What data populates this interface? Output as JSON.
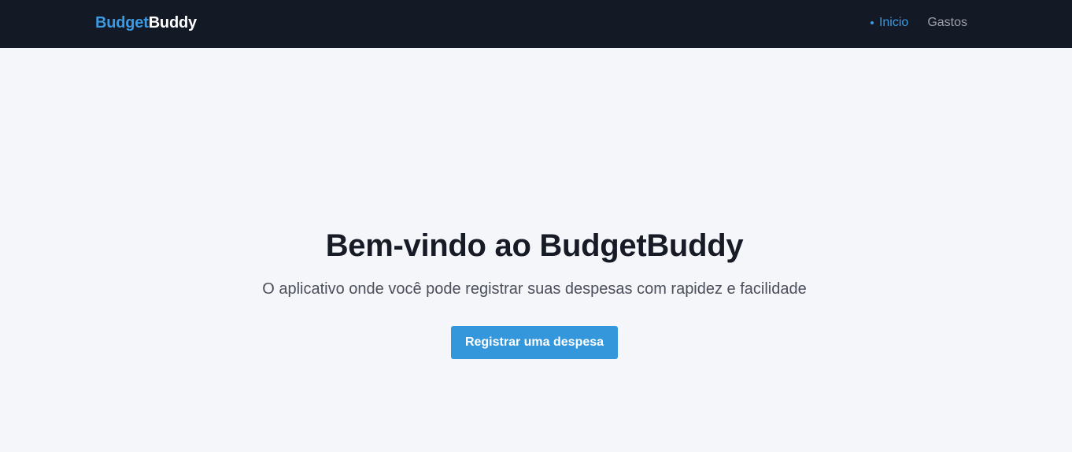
{
  "navbar": {
    "brand": {
      "part1": "Budget",
      "part2": "Buddy"
    },
    "links": [
      {
        "label": "Inicio",
        "active": true
      },
      {
        "label": "Gastos",
        "active": false
      }
    ]
  },
  "hero": {
    "title": "Bem-vindo ao BudgetBuddy",
    "subtitle": "O aplicativo onde você pode registrar suas despesas com rapidez e facilidade",
    "cta_label": "Registrar uma despesa"
  },
  "colors": {
    "navbar_bg": "#141926",
    "accent": "#3b9ae1",
    "page_bg": "#f5f6fa",
    "button_bg": "#3496db",
    "title_text": "#171b26"
  }
}
